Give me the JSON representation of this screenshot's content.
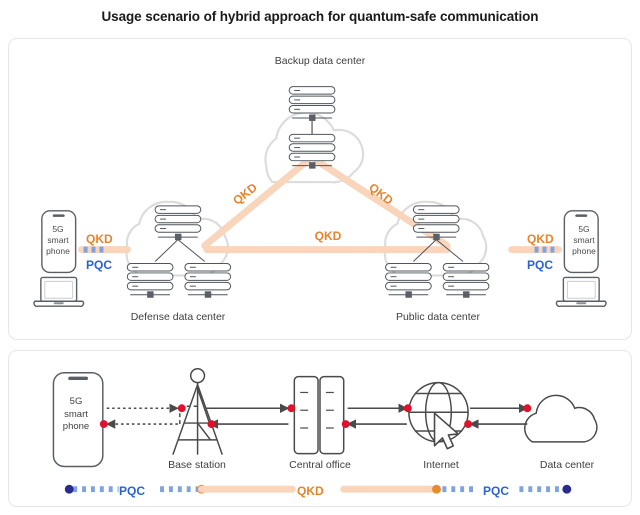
{
  "title": "Usage scenario of hybrid approach for quantum-safe communication",
  "colors": {
    "qkd_line": "#f8d5bb",
    "qkd_text": "#e8832a",
    "pqc_text": "#2a62d6",
    "pqc_dash": "#7fa3e0",
    "pqc_endpoint": "#2b2b8f",
    "qkd_endpoint": "#ea8a2e",
    "node_dot": "#e0112b",
    "line_gray": "#4a4a4a",
    "device_outline": "#5a5f66",
    "cloud_outline": "#dcdcdc",
    "panel_border": "#e6e6e6",
    "rack_outline": "#4f555c"
  },
  "top_panel": {
    "name": "hybrid-network-topology",
    "nodes": [
      {
        "id": "backup",
        "label": "Backup data center",
        "type": "cloud-datacenter",
        "racks": 2
      },
      {
        "id": "defense",
        "label": "Defense data center",
        "type": "cloud-datacenter",
        "racks": 3
      },
      {
        "id": "public",
        "label": "Public data center",
        "type": "cloud-datacenter",
        "racks": 3
      }
    ],
    "endpoints": [
      {
        "id": "left",
        "phone_label": "5G\nsmart\nphone",
        "phone_lines": [
          "5G",
          "smart",
          "phone"
        ],
        "devices": [
          "smartphone",
          "laptop"
        ]
      },
      {
        "id": "right",
        "phone_label": "5G\nsmart\nphone",
        "phone_lines": [
          "5G",
          "smart",
          "phone"
        ],
        "devices": [
          "smartphone",
          "laptop"
        ]
      }
    ],
    "links": [
      {
        "from": "defense",
        "to": "backup",
        "label": "QKD",
        "style": "solid-peach"
      },
      {
        "from": "backup",
        "to": "public",
        "label": "QKD",
        "style": "solid-peach"
      },
      {
        "from": "defense",
        "to": "public",
        "label": "QKD",
        "style": "solid-peach"
      }
    ],
    "edge_links": [
      {
        "side": "left",
        "upper_label": "QKD",
        "lower_label": "PQC"
      },
      {
        "side": "right",
        "upper_label": "QKD",
        "lower_label": "PQC"
      }
    ]
  },
  "bottom_panel": {
    "name": "end-to-end-path",
    "nodes": [
      {
        "id": "phone",
        "label": "5G smart phone",
        "label_lines": [
          "5G",
          "smart",
          "phone"
        ],
        "icon": "smartphone"
      },
      {
        "id": "base",
        "label": "Base station",
        "icon": "tower"
      },
      {
        "id": "central",
        "label": "Central office",
        "icon": "server-cabinets"
      },
      {
        "id": "internet",
        "label": "Internet",
        "icon": "globe-cursor"
      },
      {
        "id": "dc",
        "label": "Data center",
        "icon": "cloud"
      }
    ],
    "segments": [
      {
        "label": "PQC",
        "style": "blue-dotted",
        "from": "phone",
        "to": "base"
      },
      {
        "label": "QKD",
        "style": "solid-peach",
        "from": "base",
        "to": "internet"
      },
      {
        "label": "PQC",
        "style": "blue-dotted",
        "from": "internet",
        "to": "dc"
      }
    ]
  }
}
